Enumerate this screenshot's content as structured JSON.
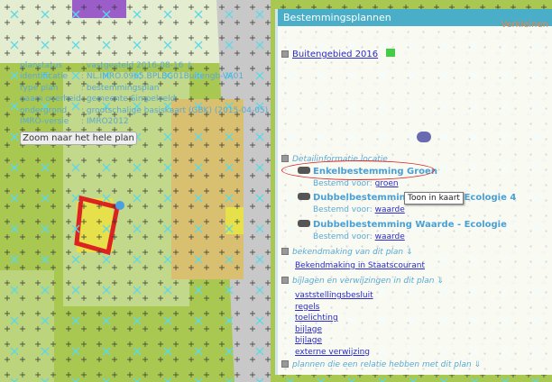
{
  "panel": {
    "title": "Bestemmingsplannen",
    "collapse": "Verkleinen"
  },
  "plan": {
    "name": "Buitengebied 2016",
    "props": [
      {
        "k": "planstatus",
        "v": ": vastgesteld 2016-08-16"
      },
      {
        "k": "identificatie",
        "v": ": NL.IMRO.0965.BPLBG01Buitengb-VA01"
      },
      {
        "k": "type plan",
        "v": ": bestemmingsplan"
      },
      {
        "k": "naam overheid",
        "v": ": gemeente Simpelveld"
      },
      {
        "k": "ondergrond",
        "v": ": grootschalige basiskaart (GBK) (2015-04-05)"
      },
      {
        "k": "IMRO-versie",
        "v": ": IMRO2012"
      }
    ],
    "zoom_button": "Zoom naar het hele plan"
  },
  "detail": {
    "title": "Detailinformatie locatie",
    "bestemd_label": "Bestemd voor:",
    "items": [
      {
        "name": "Enkelbestemming Groen",
        "value": "groen"
      },
      {
        "name": "Dubbelbestemming Waarde - Ecologie 4",
        "value": "waarde"
      },
      {
        "name": "Dubbelbestemming Waarde - Ecologie",
        "value": "waarde"
      }
    ]
  },
  "tooltip": "Toon in kaart",
  "bekend": {
    "title": "bekendmaking van dit plan",
    "link": "Bekendmaking in Staatscourant"
  },
  "bijlagen": {
    "title": "bijlagen en verwijzingen in dit plan",
    "links": [
      "vaststellingsbesluit",
      "regels",
      "toelichting",
      "bijlage",
      "bijlage",
      "externe verwijzing"
    ]
  },
  "relaties": {
    "title": "plannen die een relatie hebben met dit plan"
  }
}
